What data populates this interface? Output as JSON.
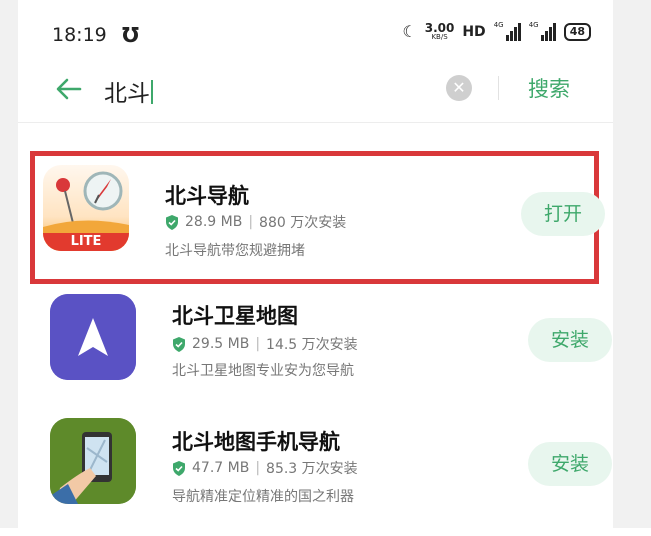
{
  "status_bar": {
    "time": "18:19",
    "net_speed_value": "3.00",
    "net_speed_unit": "KB/S",
    "hd_label": "HD",
    "signal1_label": "4G",
    "signal2_label": "4G",
    "battery": "48"
  },
  "search": {
    "query": "北斗",
    "clear_symbol": "✕",
    "button_label": "搜索"
  },
  "results": [
    {
      "name": "北斗导航",
      "size": "28.9 MB",
      "installs": "880 万次安装",
      "description": "北斗导航带您规避拥堵",
      "action": "打开",
      "icon_badge": "LITE"
    },
    {
      "name": "北斗卫星地图",
      "size": "29.5 MB",
      "installs": "14.5 万次安装",
      "description": "北斗卫星地图专业安为您导航",
      "action": "安装"
    },
    {
      "name": "北斗地图手机导航",
      "size": "47.7 MB",
      "installs": "85.3 万次安装",
      "description": "导航精准定位精准的国之利器",
      "action": "安装"
    }
  ],
  "colors": {
    "accent": "#3ea86b",
    "highlight_border": "#d9383a",
    "button_bg": "#e8f6ee"
  }
}
